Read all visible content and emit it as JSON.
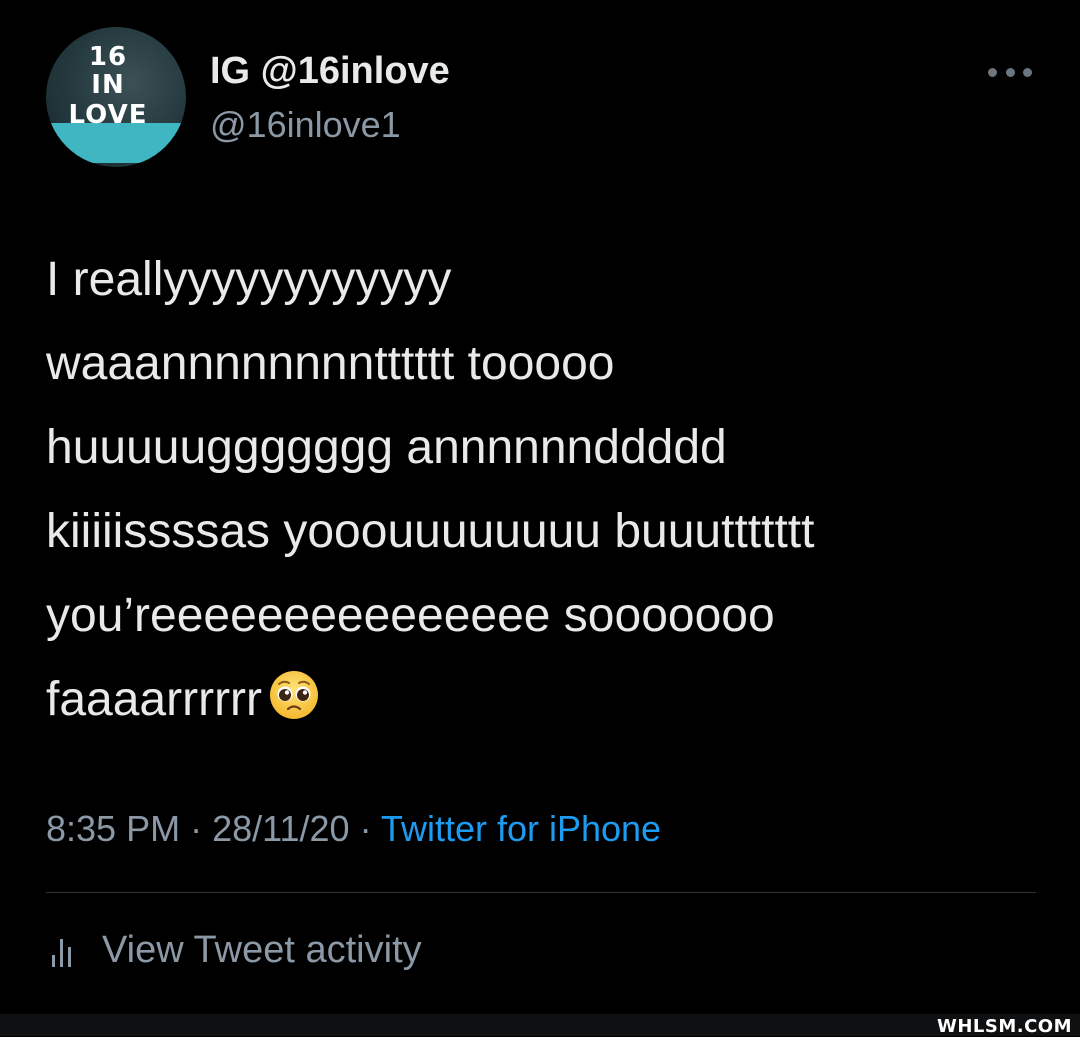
{
  "account": {
    "display_name": "IG @16inlove",
    "handle": "@16inlove1",
    "avatar_text": [
      "16",
      "IN",
      "LOVE"
    ]
  },
  "tweet": {
    "lines": [
      "I reallyyyyyyyyyyyy",
      "waaannnnnnnntttttt tooooo",
      "huuuuuggggggg annnnnnddddd",
      "kiiiiissssas yooouuuuuuuu buuuttttttt",
      "you’reeeeeeeeeeeeeee sooooooo",
      "faaaarrrrrr"
    ],
    "emoji": "pleading-face-emoji"
  },
  "meta": {
    "time": "8:35 PM",
    "separator": "·",
    "date": "28/11/20",
    "source": "Twitter for iPhone"
  },
  "actions": {
    "activity_label": "View Tweet activity",
    "more_icon": "more-horizontal-icon",
    "activity_icon": "bar-chart-icon"
  },
  "watermark": "WHLSM.COM",
  "colors": {
    "background": "#000000",
    "text": "#e7e9ea",
    "secondary": "#8b98a5",
    "link": "#1d9bf0"
  }
}
